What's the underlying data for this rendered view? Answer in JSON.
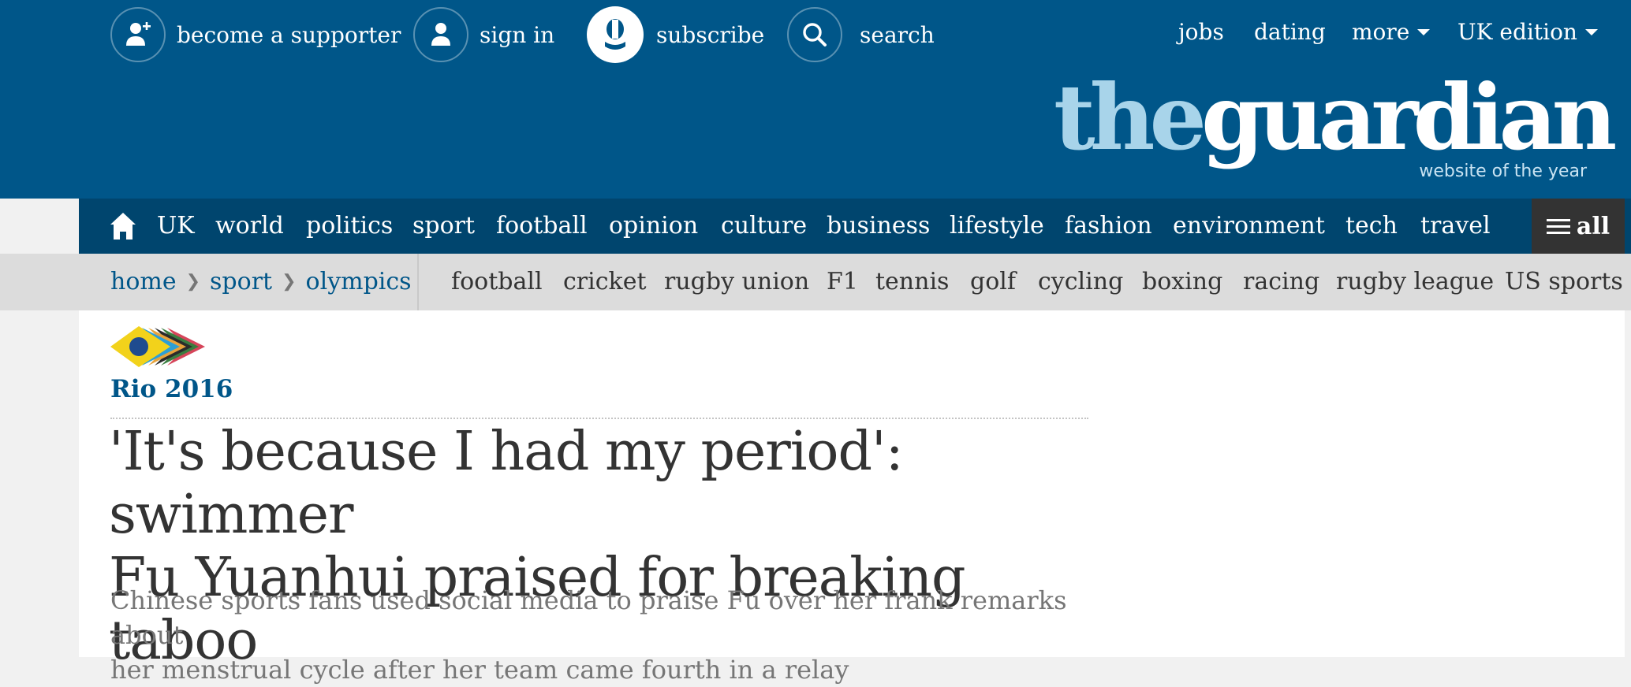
{
  "header": {
    "utility": {
      "supporter_label": "become a supporter",
      "signin_label": "sign in",
      "subscribe_label": "subscribe",
      "search_label": "search"
    },
    "links": {
      "jobs": "jobs",
      "dating": "dating",
      "more": "more",
      "edition": "UK edition"
    },
    "logo": {
      "the": "the",
      "guardian": "guardian",
      "tagline": "website of the year"
    },
    "colors": {
      "brand_blue": "#005689",
      "nav_blue": "#00456e",
      "logo_light": "#a8d4ea"
    }
  },
  "main_nav": {
    "items": [
      "UK",
      "world",
      "politics",
      "sport",
      "football",
      "opinion",
      "culture",
      "business",
      "lifestyle",
      "fashion",
      "environment",
      "tech",
      "travel"
    ],
    "all_label": "all"
  },
  "sub_nav": {
    "breadcrumbs": [
      "home",
      "sport",
      "olympics"
    ],
    "items": [
      "football",
      "cricket",
      "rugby union",
      "F1",
      "tennis",
      "golf",
      "cycling",
      "boxing",
      "racing",
      "rugby league",
      "US sports"
    ]
  },
  "article": {
    "series": "Rio 2016",
    "headline_line1": "'It's because I had my period': swimmer",
    "headline_line2": "Fu Yuanhui praised for breaking taboo",
    "standfirst_line1": "Chinese sports fans used social media to praise Fu over her frank remarks about",
    "standfirst_line2": "her menstrual cycle after her team came fourth in a relay"
  }
}
